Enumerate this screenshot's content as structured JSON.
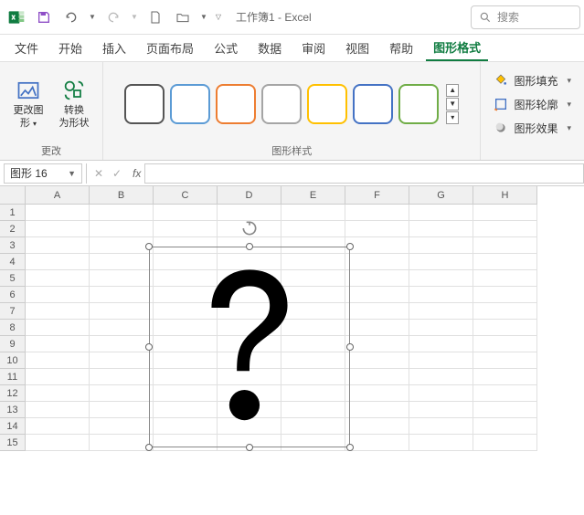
{
  "title": "工作簿1  -  Excel",
  "search": {
    "placeholder": "搜索"
  },
  "tabs": [
    "文件",
    "开始",
    "插入",
    "页面布局",
    "公式",
    "数据",
    "审阅",
    "视图",
    "帮助",
    "图形格式"
  ],
  "activeTab": 9,
  "ribbon": {
    "group1": {
      "label": "更改",
      "btn1_l1": "更改图",
      "btn1_l2": "形",
      "btn2_l1": "转换",
      "btn2_l2": "为形状"
    },
    "group2": {
      "label": "图形样式"
    },
    "shapeOpts": {
      "fill": "图形填充",
      "outline": "图形轮廓",
      "effects": "图形效果"
    }
  },
  "styleColors": [
    "#555",
    "#5b9bd5",
    "#ed7d31",
    "#a5a5a5",
    "#ffc000",
    "#4472c4",
    "#70ad47"
  ],
  "nameBox": "图形 16",
  "columns": [
    "A",
    "B",
    "C",
    "D",
    "E",
    "F",
    "G",
    "H"
  ],
  "rows": [
    "1",
    "2",
    "3",
    "4",
    "5",
    "6",
    "7",
    "8",
    "9",
    "10",
    "11",
    "12",
    "13",
    "14",
    "15"
  ]
}
